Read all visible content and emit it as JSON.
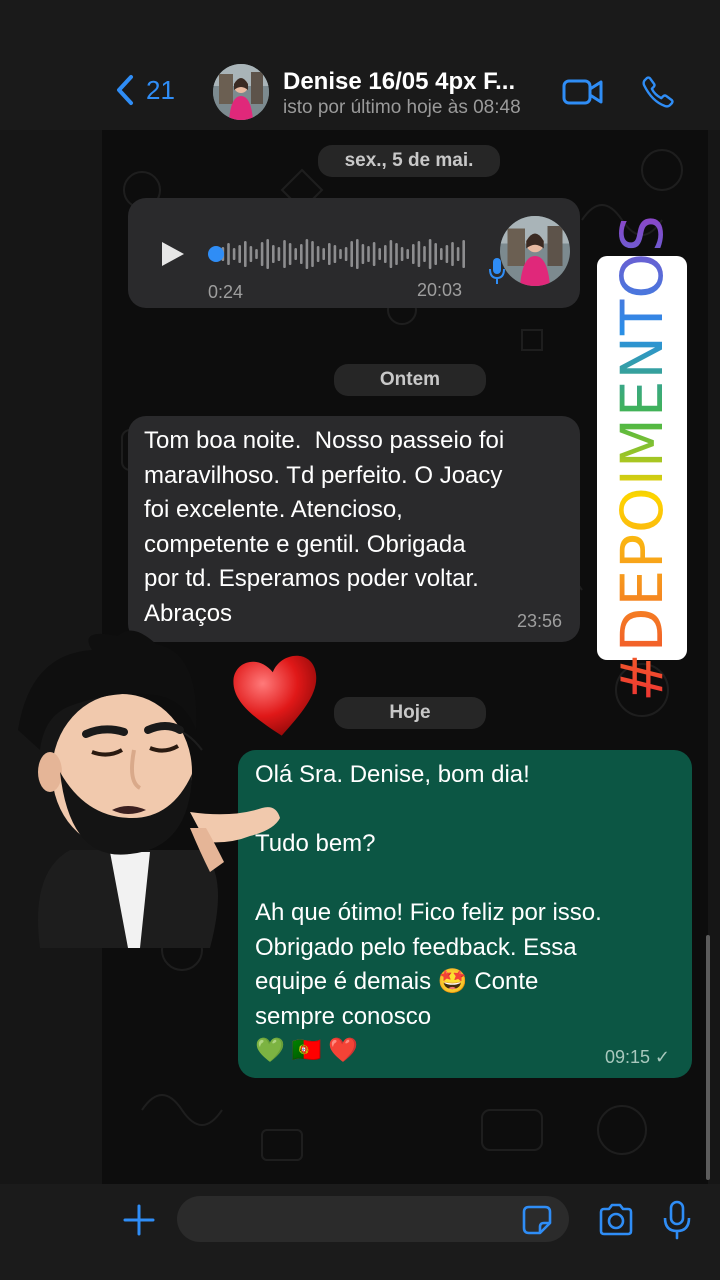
{
  "header": {
    "back_count": "21",
    "contact_name": "Denise 16/05 4px F...",
    "status": "isto por último hoje às 08:48",
    "video_icon": "video-camera-icon",
    "call_icon": "phone-icon"
  },
  "dates": {
    "first": "sex., 5 de mai.",
    "second": "Ontem",
    "third": "Hoje"
  },
  "voice_message": {
    "elapsed": "0:24",
    "time": "20:03",
    "progress": 0.0
  },
  "received_message": {
    "text": "Tom boa noite.  Nosso passeio foi\nmaravilhoso. Td perfeito. O Joacy\nfoi excelente. Atencioso,\ncompetente e gentil. Obrigada\npor td. Esperamos poder voltar.\nAbraços",
    "time": "23:56"
  },
  "sent_message": {
    "text": "Olá Sra. Denise, bom dia!\n\nTudo bem?\n\nAh que ótimo! Fico feliz por isso.\nObrigado pelo feedback. Essa\nequipe é demais 🤩 Conte\nsempre conosco\n💚 🇵🇹 ❤️",
    "time": "09:15",
    "status": "✓"
  },
  "sticker": {
    "hashtag": "#DEPOIMENTOS"
  },
  "colors": {
    "accent": "#2f8df6",
    "incoming_bubble": "#2a2a2c",
    "outgoing_bubble": "#0c5644",
    "background": "#0d0d0d"
  }
}
